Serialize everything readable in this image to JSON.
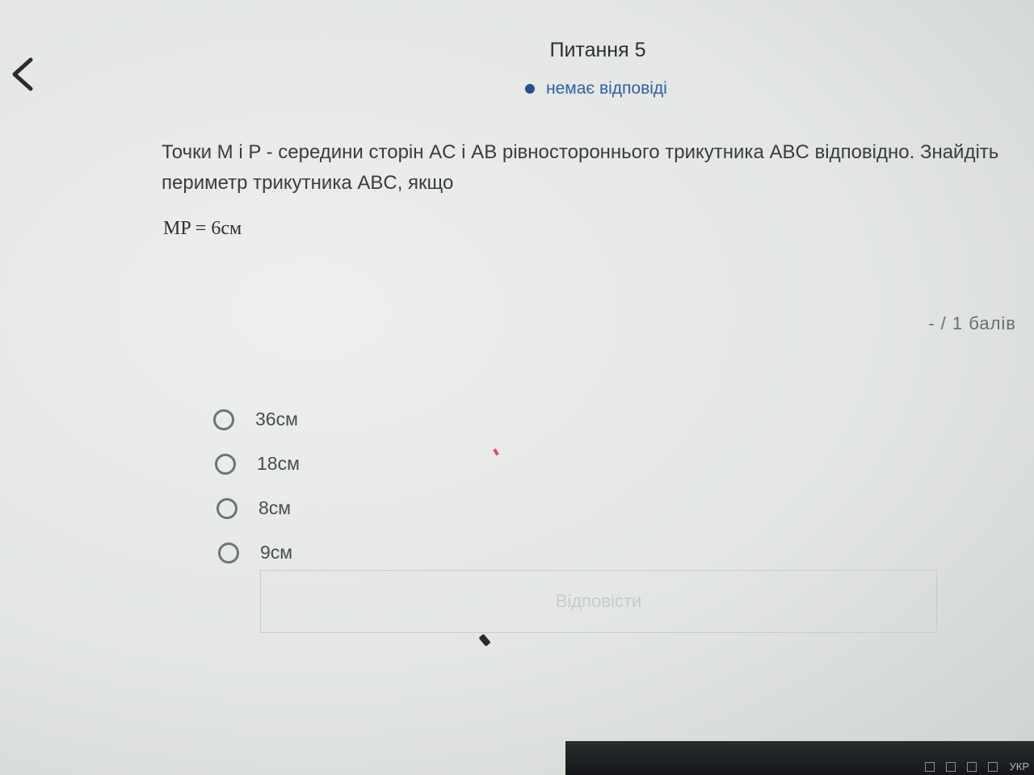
{
  "header": {
    "back_icon": "chevron-left-icon",
    "title": "Питання 5",
    "status_text": "немає відповіді",
    "status_color": "#2a4f8f"
  },
  "question": {
    "text": "Точки M і P - середини сторін AC і AB рівностороннього трикутника ABC відповідно. Знайдіть периметр трикутника ABC, якщо",
    "formula": "MP = 6см"
  },
  "score": {
    "text": "- / 1 балів"
  },
  "options": [
    {
      "label": "36см"
    },
    {
      "label": "18см"
    },
    {
      "label": "8см"
    },
    {
      "label": "9см"
    }
  ],
  "submit": {
    "label": "Відповісти"
  },
  "taskbar": {
    "language": "УКР"
  }
}
